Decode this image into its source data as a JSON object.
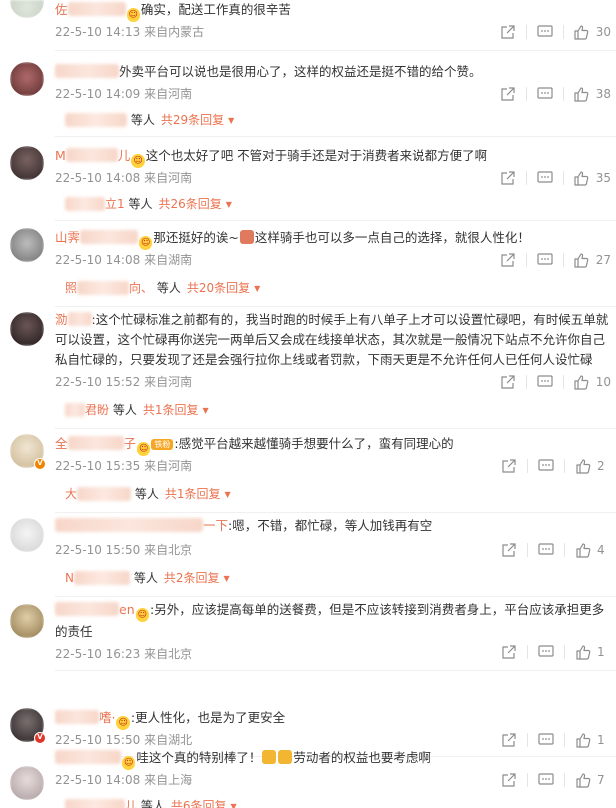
{
  "comments": [
    {
      "name_visible": "佐",
      "text": "确实，配送工作真的很辛苦",
      "date": "22-5-10 14:13",
      "source": "来自内蒙古",
      "likes": "30",
      "avatar_color": "#c9d2c7"
    },
    {
      "name_visible": "",
      "text": "外卖平台可以说也是很用心了，这样的权益还是挺不错的给个赞。",
      "date": "22-5-10 14:09",
      "source": "来自河南",
      "likes": "38",
      "avatar_color": "#8a4a4a",
      "reply_prefix": "",
      "reply_suffix": "等人",
      "reply_total": "共29条回复"
    },
    {
      "name_visible": "M",
      "name_tail": "儿",
      "text": "这个也太好了吧 不管对于骑手还是对于消费者来说都方便了啊",
      "date": "22-5-10 14:08",
      "source": "来自河南",
      "likes": "35",
      "avatar_color": "#5b4a4a",
      "reply_prefix": "",
      "reply_tail": "立1",
      "reply_suffix": "等人",
      "reply_total": "共26条回复"
    },
    {
      "name_visible": "山霁",
      "text_1": "那还挺好的诶~",
      "text_2": "这样骑手也可以多一点自己的选择，就很人性化！",
      "date": "22-5-10 14:08",
      "source": "来自湖南",
      "likes": "27",
      "avatar_color": "#8d8d8d",
      "reply_prefix": "照",
      "reply_tail": "向、",
      "reply_suffix": "等人",
      "reply_total": "共20条回复"
    },
    {
      "name_visible": "泐",
      "text": "这个忙碌标准之前都有的，我当时跑的时候手上有八单子上才可以设置忙碌吧，有时候五单就可以设置，这个忙碌再你送完一两单后又会成在线接单状态，其次就是一般情况下站点不允许你自己私自忙碌的，只要发现了还是会强行拉你上线或者罚款，下雨天更是不允许任何人已任何人设忙碌",
      "date": "22-5-10 15:52",
      "source": "来自河南",
      "likes": "10",
      "avatar_color": "#3d3131",
      "reply_prefix": "",
      "reply_tail": "君盼",
      "reply_suffix": "等人",
      "reply_total": "共1条回复"
    },
    {
      "name_visible": "全",
      "name_tail": "子",
      "fan_badge": "铁粉",
      "text": "感觉平台越来越懂骑手想要什么了，蛮有同理心的",
      "date": "22-5-10 15:35",
      "source": "来自河南",
      "likes": "2",
      "avatar_color": "#d9c9a8",
      "reply_prefix": "大",
      "reply_suffix": "等人",
      "reply_total": "共1条回复"
    },
    {
      "name_visible": "",
      "name_tail": "一下",
      "text": "嗯，不错，都忙碌，等人加钱再有空",
      "date": "22-5-10 15:50",
      "source": "来自北京",
      "likes": "4",
      "avatar_color": "#e2e2e2",
      "reply_prefix": "N",
      "reply_suffix": "等人",
      "reply_total": "共2条回复"
    },
    {
      "name_visible": "",
      "name_tail": "en",
      "text": "另外，应该提高每单的送餐费，但是不应该转接到消费者身上，平台应该承担更多的责任",
      "date": "22-5-10 16:23",
      "source": "来自北京",
      "likes": "1",
      "avatar_color": "#b9a27a"
    },
    {
      "name_visible": "",
      "name_tail": "嗜·",
      "text": "更人性化，也是为了更安全",
      "date": "22-5-10 15:50",
      "source": "来自湖北",
      "likes": "1",
      "avatar_color": "#4a4a4a"
    },
    {
      "name_visible": "",
      "text_1": "哇这个真的特别棒了！",
      "text_2": "劳动者的权益也要考虑啊",
      "date": "22-5-10 14:08",
      "source": "来自上海",
      "likes": "7",
      "avatar_color": "#c7b9b9",
      "reply_prefix": "",
      "reply_tail": "儿",
      "reply_suffix": "等人",
      "reply_total": "共6条回复"
    }
  ],
  "colors": {
    "username": "#eb7350",
    "meta": "#939393",
    "text": "#333333",
    "link": "#eb7350"
  },
  "icons": [
    "share-icon",
    "comment-icon",
    "like-icon",
    "verified-badge-icon",
    "emoji-icon"
  ]
}
